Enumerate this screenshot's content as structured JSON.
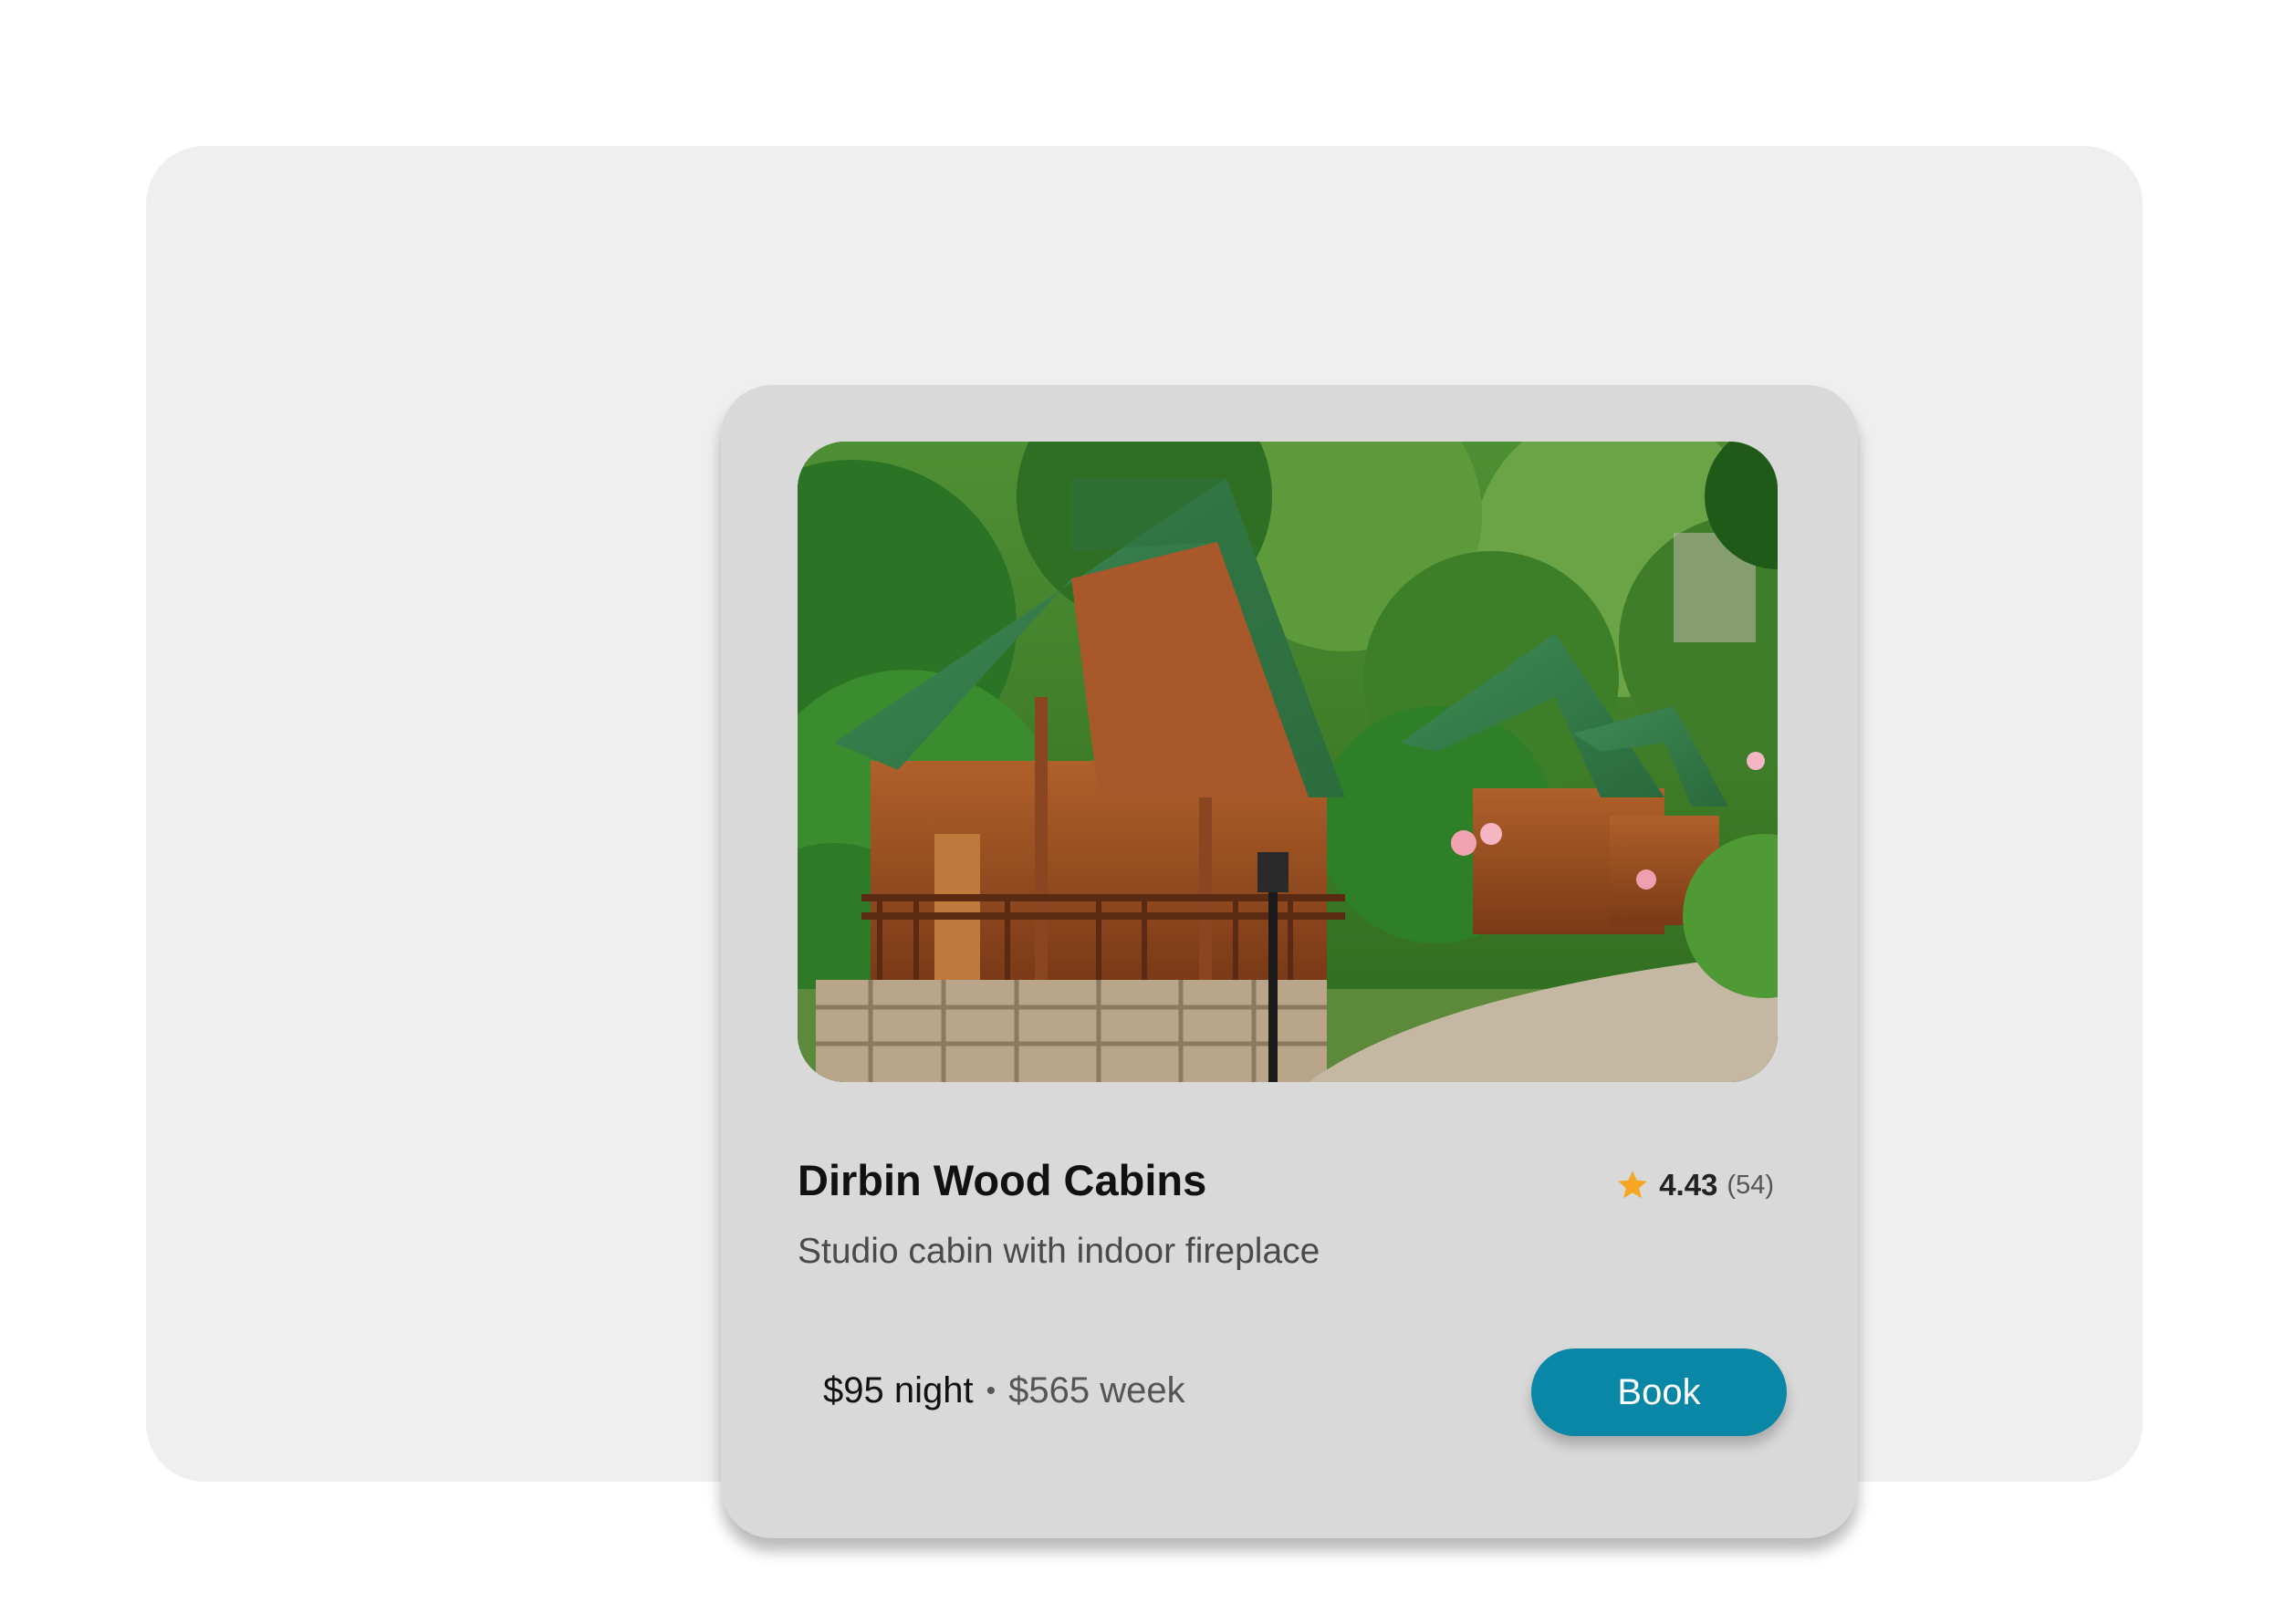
{
  "listing": {
    "title": "Dirbin Wood Cabins",
    "subtitle": "Studio cabin with indoor fireplace",
    "rating": {
      "score": "4.43",
      "count": "(54)",
      "icon": "star-icon",
      "color": "#f5a623"
    },
    "price": {
      "night": "$95 night",
      "separator": "•",
      "week": "$565 week"
    },
    "book_label": "Book",
    "accent_color": "#0a87a6"
  }
}
